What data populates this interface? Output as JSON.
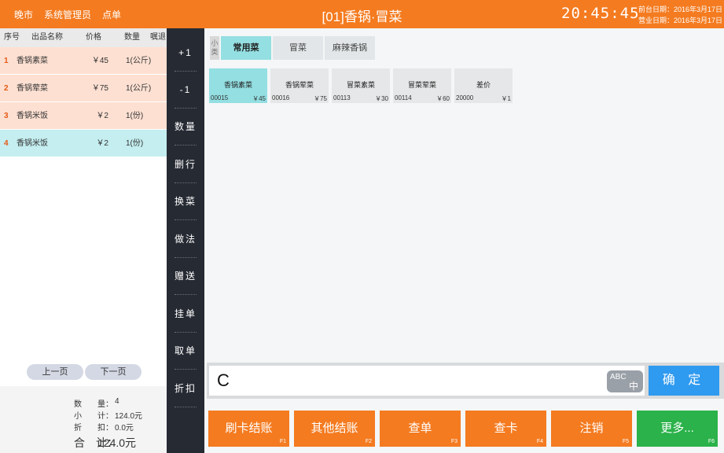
{
  "header": {
    "shift": "晚市",
    "user": "系统管理员",
    "mode": "点单",
    "title": "[01]香锅·冒菜",
    "clock": "20:45:45",
    "front_date": "前台日期：2016年3月17日",
    "business_date": "营业日期：2016年3月17日",
    "bg_color": "#f47b20"
  },
  "order": {
    "columns": [
      "序号",
      "出品名称",
      "价格",
      "数量",
      "嘱退"
    ],
    "rows": [
      {
        "idx": "1",
        "name": "香锅素菜",
        "price": "￥45",
        "qty": "1(公斤)"
      },
      {
        "idx": "2",
        "name": "香锅荤菜",
        "price": "￥75",
        "qty": "1(公斤)"
      },
      {
        "idx": "3",
        "name": "香锅米饭",
        "price": "￥2",
        "qty": "1(份)"
      },
      {
        "idx": "4",
        "name": "香锅米饭",
        "price": "￥2",
        "qty": "1(份)",
        "selected": true
      }
    ],
    "prev_page": "上一页",
    "next_page": "下一页",
    "summary": {
      "count_label": "数　　量：",
      "count": "4",
      "subtotal_label": "小　　计：",
      "subtotal": "124.0元",
      "discount_label": "折　　扣：",
      "discount": "0.0元",
      "total_label": "合　计：",
      "total": "124.0元"
    }
  },
  "actions": [
    "+1",
    "-1",
    "数量",
    "删行",
    "换菜",
    "做法",
    "赠送",
    "挂单",
    "取单",
    "折扣"
  ],
  "categories": {
    "label": "小类",
    "tabs": [
      {
        "label": "常用菜",
        "active": true
      },
      {
        "label": "冒菜"
      },
      {
        "label": "麻辣香锅"
      }
    ]
  },
  "dishes": [
    {
      "name": "香锅素菜",
      "code": "00015",
      "price": "￥45",
      "active": true
    },
    {
      "name": "香锅荤菜",
      "code": "00016",
      "price": "￥75"
    },
    {
      "name": "冒菜素菜",
      "code": "00113",
      "price": "￥30"
    },
    {
      "name": "冒菜荤菜",
      "code": "00114",
      "price": "￥60"
    },
    {
      "name": "差价",
      "code": "20000",
      "price": "￥1"
    }
  ],
  "input": {
    "value": "C",
    "ime_abc": "ABC",
    "ime_zh": "中",
    "confirm": "确 定"
  },
  "pay_buttons": [
    {
      "label": "刷卡结账",
      "key": "F1"
    },
    {
      "label": "其他结账",
      "key": "F2"
    },
    {
      "label": "查单",
      "key": "F3"
    },
    {
      "label": "查卡",
      "key": "F4"
    },
    {
      "label": "注销",
      "key": "F5"
    },
    {
      "label": "更多...",
      "key": "F6",
      "color": "green"
    }
  ]
}
